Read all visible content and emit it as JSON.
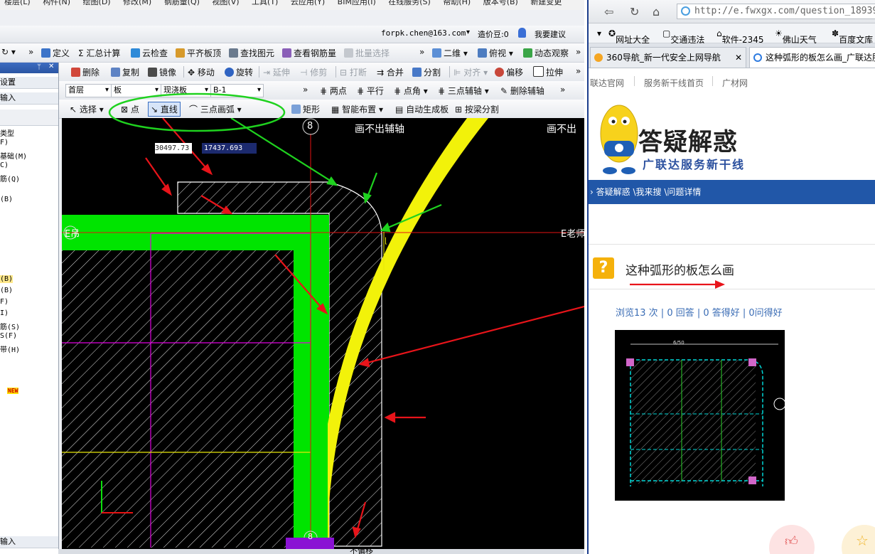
{
  "app": {
    "menu": [
      "楼层(L)",
      "构件(N)",
      "绘图(D)",
      "修改(M)",
      "钢筋量(Q)",
      "视图(V)",
      "工具(T)",
      "云应用(Y)",
      "BIM应用(I)",
      "在线服务(S)",
      "帮助(H)",
      "版本号(B)",
      "新建变更"
    ],
    "user": {
      "email": "forpk.chen@163.com",
      "price": "造价豆:0",
      "suggest": "我要建议"
    },
    "toolbar1": [
      "定义",
      "汇总计算",
      "云检查",
      "平齐板顶",
      "查找图元",
      "查看钢筋量",
      "批量选择",
      "二维",
      "俯视",
      "动态观察"
    ],
    "toolbar2": [
      "删除",
      "复制",
      "镜像",
      "移动",
      "旋转",
      "延伸",
      "修剪",
      "打断",
      "合并",
      "分割",
      "对齐",
      "偏移",
      "拉伸"
    ],
    "toolbar3": {
      "floor": "首层",
      "type": "板",
      "subtype": "现浇板",
      "name": "B-1",
      "items": [
        "两点",
        "平行",
        "点角",
        "三点辅轴",
        "删除辅轴"
      ]
    },
    "toolbar4": [
      "选择",
      "点",
      "直线",
      "三点画弧",
      "矩形",
      "智能布置",
      "自动生成板",
      "按梁分割"
    ],
    "left_panel": {
      "rows": [
        "设置",
        "输入"
      ],
      "items": [
        "类型",
        "F)",
        "基础(M)",
        "C)",
        "筋(Q)",
        "(B)",
        "(B)",
        "(B)",
        "F)",
        "I)",
        "筋(S)",
        "S(F)",
        "带(H)",
        "NEW"
      ],
      "bottom": "输入"
    },
    "canvas": {
      "coord_x": "30497.73",
      "coord_y": "17437.693",
      "axis_top": "8",
      "label_top_1": "画不出辅轴",
      "label_top_2": "画不出",
      "label_left": "E吊",
      "label_right": "E老师",
      "axis_bottom": "8"
    },
    "status_text": "不偏移"
  },
  "browser": {
    "url": "http://e.fwxgx.com/question_18939",
    "bookmarks": [
      "网址大全",
      "交通违法",
      "软件-2345",
      "佛山天气",
      "百度文库"
    ],
    "tabs": [
      "360导航_新一代安全上网导航",
      "这种弧形的板怎么画_广联达服务新干线"
    ],
    "site_links": [
      "联达官网",
      "服务新干线首页",
      "广材网"
    ],
    "banner_title": "答疑解惑",
    "banner_subtitle": "广联达服务新干线",
    "breadcrumb": "答疑解惑 \\我来搜 \\问题详情",
    "question_title": "这种弧形的板怎么画",
    "question_stats": "浏览13 次 | 0 回答 | 0 答得好 | 0问得好",
    "thumb_dim": "6/50"
  },
  "colors": {
    "annot_red": "#e8141a",
    "annot_green": "#1fd21f",
    "slab_green": "#00e400",
    "arc_yellow": "#f2f20a",
    "link_blue": "#2157a8"
  }
}
